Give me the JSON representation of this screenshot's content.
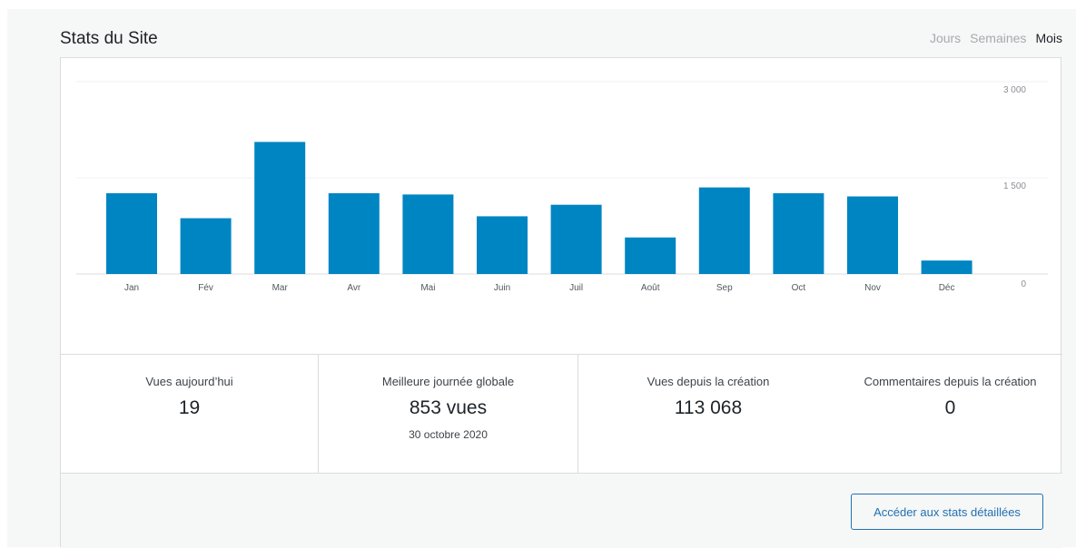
{
  "header": {
    "title": "Stats du Site",
    "tabs": [
      {
        "label": "Jours",
        "active": false
      },
      {
        "label": "Semaines",
        "active": false
      },
      {
        "label": "Mois",
        "active": true
      }
    ]
  },
  "chart_data": {
    "type": "bar",
    "categories": [
      "Jan",
      "Fév",
      "Mar",
      "Avr",
      "Mai",
      "Juin",
      "Juil",
      "Août",
      "Sep",
      "Oct",
      "Nov",
      "Déc"
    ],
    "values": [
      1260,
      870,
      2060,
      1260,
      1240,
      900,
      1080,
      570,
      1350,
      1260,
      1210,
      210
    ],
    "ytick_labels": [
      "3 000",
      "1 500",
      "0"
    ],
    "ytick_values": [
      3000,
      1500,
      0
    ],
    "ylim": [
      0,
      3000
    ],
    "bar_color": "#0085c3",
    "grid": true
  },
  "stats": {
    "today": {
      "label": "Vues aujourd’hui",
      "value": "19"
    },
    "best_day": {
      "label": "Meilleure journée globale",
      "value": "853 vues",
      "date": "30 octobre 2020"
    },
    "total_views": {
      "label": "Vues depuis la création",
      "value": "113 068"
    },
    "total_comments": {
      "label": "Commentaires depuis la création",
      "value": "0"
    }
  },
  "footer": {
    "detail_button": "Accéder aux stats détaillées"
  },
  "colors": {
    "accent": "#2271b1",
    "bar": "#0085c3"
  }
}
